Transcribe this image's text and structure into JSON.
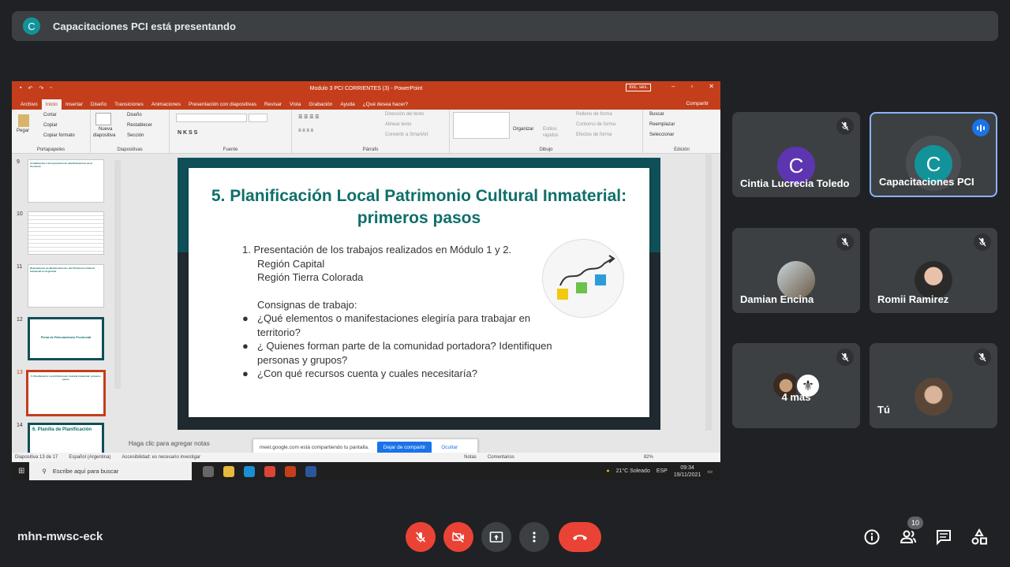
{
  "meet": {
    "presenter_initial": "C",
    "presenting_text": "Capacitaciones PCI está presentando",
    "meeting_code": "mhn-mwsc-eck",
    "participant_count": "10"
  },
  "ppt": {
    "window_title": "Modulo 3 PCI CORRIENTES (3)  -  PowerPoint",
    "login": "Inic. ses.",
    "tabs": [
      "Archivo",
      "Inicio",
      "Insertar",
      "Diseño",
      "Transiciones",
      "Animaciones",
      "Presentación con diapositivas",
      "Revisar",
      "Vista",
      "Grabación",
      "Ayuda",
      "¿Qué desea hacer?"
    ],
    "share": "Compartir",
    "ribbon": {
      "cortar": "Cortar",
      "copiar": "Copiar",
      "pegar": "Pegar",
      "copiar_formato": "Copiar formato",
      "portapapeles": "Portapapeles",
      "nueva": "Nueva",
      "diapositiva": "diapositiva",
      "diseno": "Diseño",
      "restablecer": "Restablecer",
      "seccion": "Sección",
      "diapositivas": "Diapositivas",
      "fuente": "Fuente",
      "parrafo": "Párrafo",
      "direccion": "Dirección del texto",
      "alinear": "Alinear texto",
      "convertir": "Convertir a SmartArt",
      "organizar": "Organizar",
      "estilos": "Estilos",
      "rapidos": "rápidos",
      "relleno": "Relleno de forma",
      "contorno": "Contorno de forma",
      "efectos": "Efectos de forma",
      "dibujo": "Dibujo",
      "buscar": "Buscar",
      "reemplazar": "Reemplazar",
      "seleccionar": "Seleccionar",
      "edicion": "Edición"
    },
    "thumbs": [
      {
        "num": "9",
        "title": "Actualización e Incorporación de manifestaciones de la Provincia"
      },
      {
        "num": "10",
        "title": ""
      },
      {
        "num": "11",
        "title": "Relevamiento de Manifestaciones del Patrimonio Cultural Inmaterial en Argentina"
      },
      {
        "num": "12",
        "title": "Ficha de Relevamiento Provincial"
      },
      {
        "num": "13",
        "title": "5. Planificación Local Patrimonio Cultural Inmaterial: primeros pasos"
      },
      {
        "num": "14",
        "title": "6. Planilla de Planificación"
      }
    ],
    "slide": {
      "title": "5. Planificación Local Patrimonio Cultural Inmaterial: primeros pasos",
      "item1": "1.   Presentación de los trabajos realizados en Módulo 1 y 2.",
      "region1": "Región Capital",
      "region2": "Región Tierra Colorada",
      "consignas": "Consignas de trabajo:",
      "bullets": [
        "¿Qué elementos o manifestaciones elegiría  para trabajar en territorio?",
        "¿ Quienes forman parte de la comunidad portadora? Identifiquen personas y grupos?",
        "¿Con qué recursos cuenta y cuales necesitaría?"
      ]
    },
    "notes_placeholder": "Haga clic para agregar notas",
    "share_bar": {
      "text": "meet.google.com está compartiendo tu pantalla.",
      "stop": "Dejar de compartir",
      "hide": "Ocultar"
    },
    "status": {
      "slide": "Diapositiva 13 de 17",
      "lang": "Español (Argentina)",
      "access": "Accesibilidad: es necesario investigar",
      "notas": "Notas",
      "comentarios": "Comentarios",
      "zoom": "82%"
    },
    "taskbar": {
      "search": "Escribe aquí para buscar",
      "weather": "21°C  Soleado",
      "lang": "ESP",
      "time": "09:34",
      "date": "19/11/2021"
    }
  },
  "participants": [
    {
      "name": "Cintia Lucrecia Toledo",
      "initial": "C",
      "color": "#5e35b1"
    },
    {
      "name": "Capacitaciones PCI",
      "initial": "C",
      "color": "#12939a"
    },
    {
      "name": "Damian Encina"
    },
    {
      "name": "Romii Ramirez"
    },
    {
      "name": "4 más"
    },
    {
      "name": "Tú"
    }
  ]
}
